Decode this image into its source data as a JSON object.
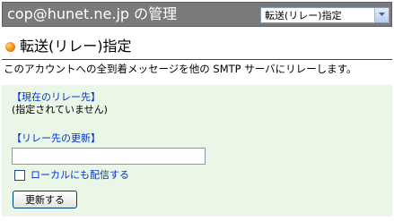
{
  "header": {
    "title": "cop@hunet.ne.jp の管理",
    "menu_selected": "転送(リレー)指定"
  },
  "section": {
    "title": "転送(リレー)指定",
    "description": "このアカウントへの全到着メッセージを他の SMTP サーバにリレーします。"
  },
  "form": {
    "current_label": "【現在のリレー先】",
    "current_value": "(指定されていません)",
    "update_label": "【リレー先の更新】",
    "relay_input_value": "",
    "local_delivery_label": "ローカルにも配信する",
    "local_delivery_checked": false,
    "submit_label": "更新する"
  },
  "colors": {
    "header_bg": "#7a7a7a",
    "panel_bg": "#eaf7e6",
    "label_blue": "#0033cc",
    "bullet_orange": "#f7941d"
  },
  "icons": {
    "bullet": "orange-dot-icon",
    "dropdown": "chevron-down-icon"
  }
}
